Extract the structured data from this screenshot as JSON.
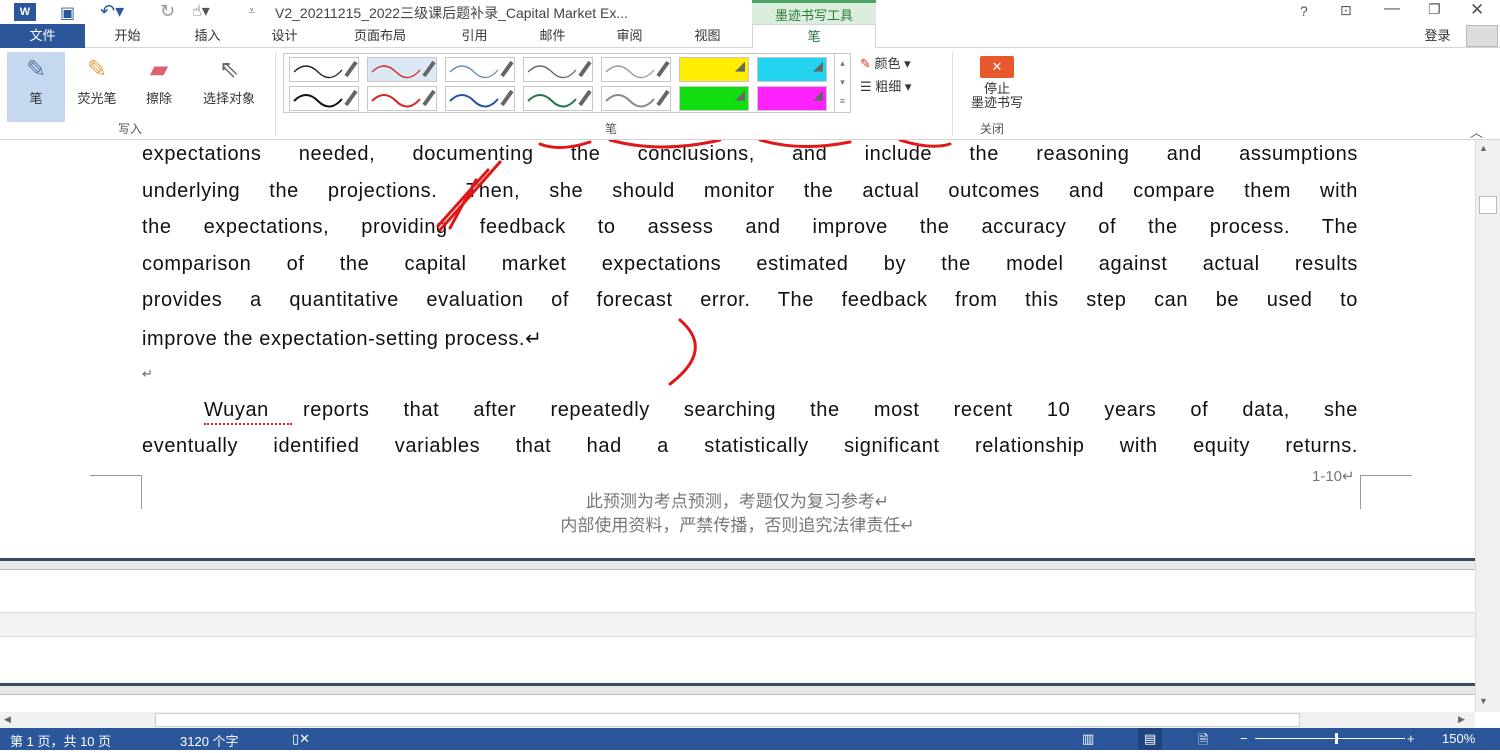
{
  "titlebar": {
    "title": "V2_20211215_2022三级课后题补录_Capital Market Ex...",
    "context_tab": "墨迹书写工具",
    "help": "?",
    "login": "登录"
  },
  "tabs": [
    {
      "label": "文件"
    },
    {
      "label": "开始"
    },
    {
      "label": "插入"
    },
    {
      "label": "设计"
    },
    {
      "label": "页面布局"
    },
    {
      "label": "引用"
    },
    {
      "label": "邮件"
    },
    {
      "label": "审阅"
    },
    {
      "label": "视图"
    },
    {
      "label": "笔"
    }
  ],
  "ribbon": {
    "write_group": {
      "label": "写入",
      "buttons": [
        {
          "label": "笔"
        },
        {
          "label": "荧光笔"
        },
        {
          "label": "擦除"
        },
        {
          "label": "选择对象"
        }
      ]
    },
    "pens_group": {
      "label": "笔",
      "color_label": "颜色",
      "thickness_label": "粗细"
    },
    "pens": [
      "#222222",
      "#d22",
      "#6a8ac0",
      "#666666",
      "#999999",
      "#ffee00",
      "#22d4f0",
      "#111111",
      "#d22",
      "#2a4fa0",
      "#1f7a4a",
      "#888888",
      "#11dd11",
      "#ff22ff"
    ],
    "close_group": {
      "label": "关闭",
      "stop_label_1": "停止",
      "stop_label_2": "墨迹书写"
    }
  },
  "document": {
    "lines": [
      "expectations needed, documenting the conclusions, and include the reasoning and assumptions",
      "underlying the projections. Then, she should monitor the actual outcomes and compare them with",
      "the expectations, providing feedback to assess and improve the accuracy of the process. The",
      "comparison of the capital market expectations estimated by the model against actual results",
      "provides a quantitative evaluation of forecast error. The feedback from this step can be used to",
      "improve the expectation-setting process.↵"
    ],
    "empty_para": "↵",
    "para2_lines": [
      "Wuyan reports that after repeatedly searching the most recent 10 years of data, she",
      "eventually identified variables that had a statistically significant relationship with equity returns."
    ],
    "page_number": "1-10↵",
    "footer_1": "此预测为考点预测，考题仅为复习参考↵",
    "footer_2": "内部使用资料，严禁传播，否则追究法律责任↵"
  },
  "status": {
    "page": "第 1 页，共 10 页",
    "words": "3120 个字",
    "zoom": "150%",
    "zoom_fraction": 0.5
  }
}
